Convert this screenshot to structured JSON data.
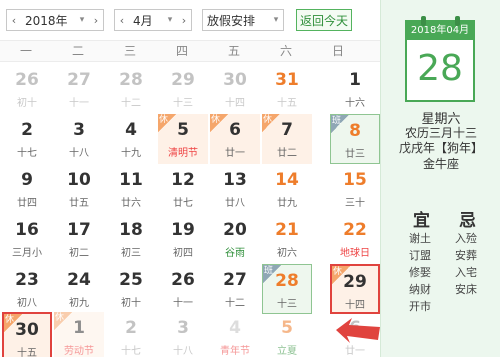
{
  "toolbar": {
    "year": "2018年",
    "month": "4月",
    "holiday_select": "放假安排",
    "today_button": "返回今天"
  },
  "weekdays": [
    "一",
    "二",
    "三",
    "四",
    "五",
    "六",
    "日"
  ],
  "calendar": {
    "badges": {
      "rest": "休",
      "work": "班"
    },
    "weeks": [
      [
        {
          "d": "26",
          "l": "初十"
        },
        {
          "d": "27",
          "l": "十一"
        },
        {
          "d": "28",
          "l": "十二"
        },
        {
          "d": "29",
          "l": "十三"
        },
        {
          "d": "30",
          "l": "十四"
        },
        {
          "d": "31",
          "l": "十五"
        },
        {
          "d": "1",
          "l": "十六"
        }
      ],
      [
        {
          "d": "2",
          "l": "十七"
        },
        {
          "d": "3",
          "l": "十八"
        },
        {
          "d": "4",
          "l": "十九"
        },
        {
          "d": "5",
          "l": "清明节"
        },
        {
          "d": "6",
          "l": "廿一"
        },
        {
          "d": "7",
          "l": "廿二"
        },
        {
          "d": "8",
          "l": "廿三"
        }
      ],
      [
        {
          "d": "9",
          "l": "廿四"
        },
        {
          "d": "10",
          "l": "廿五"
        },
        {
          "d": "11",
          "l": "廿六"
        },
        {
          "d": "12",
          "l": "廿七"
        },
        {
          "d": "13",
          "l": "廿八"
        },
        {
          "d": "14",
          "l": "廿九"
        },
        {
          "d": "15",
          "l": "三十"
        }
      ],
      [
        {
          "d": "16",
          "l": "三月小"
        },
        {
          "d": "17",
          "l": "初二"
        },
        {
          "d": "18",
          "l": "初三"
        },
        {
          "d": "19",
          "l": "初四"
        },
        {
          "d": "20",
          "l": "谷雨"
        },
        {
          "d": "21",
          "l": "初六"
        },
        {
          "d": "22",
          "l": "地球日"
        }
      ],
      [
        {
          "d": "23",
          "l": "初八"
        },
        {
          "d": "24",
          "l": "初九"
        },
        {
          "d": "25",
          "l": "初十"
        },
        {
          "d": "26",
          "l": "十一"
        },
        {
          "d": "27",
          "l": "十二"
        },
        {
          "d": "28",
          "l": "十三"
        },
        {
          "d": "29",
          "l": "十四"
        }
      ],
      [
        {
          "d": "30",
          "l": "十五"
        },
        {
          "d": "1",
          "l": "劳动节"
        },
        {
          "d": "2",
          "l": "十七"
        },
        {
          "d": "3",
          "l": "十八"
        },
        {
          "d": "4",
          "l": "青年节"
        },
        {
          "d": "5",
          "l": "立夏"
        },
        {
          "d": "6",
          "l": "廿一"
        }
      ]
    ]
  },
  "side": {
    "year_month": "2018年04月",
    "day": "28",
    "weekday": "星期六",
    "lunar": "农历三月十三",
    "ganzhi": "戊戌年【狗年】",
    "zodiac": "金牛座",
    "yi_title": "宜",
    "ji_title": "忌",
    "yi": [
      "谢土",
      "订盟",
      "修娶",
      "纳财",
      "开市"
    ],
    "ji": [
      "入殓",
      "安葬",
      "入宅",
      "安床"
    ]
  },
  "colors": {
    "accent_green": "#49a856",
    "weekend_orange": "#ee7d2b",
    "highlight_red": "#e0433e"
  }
}
